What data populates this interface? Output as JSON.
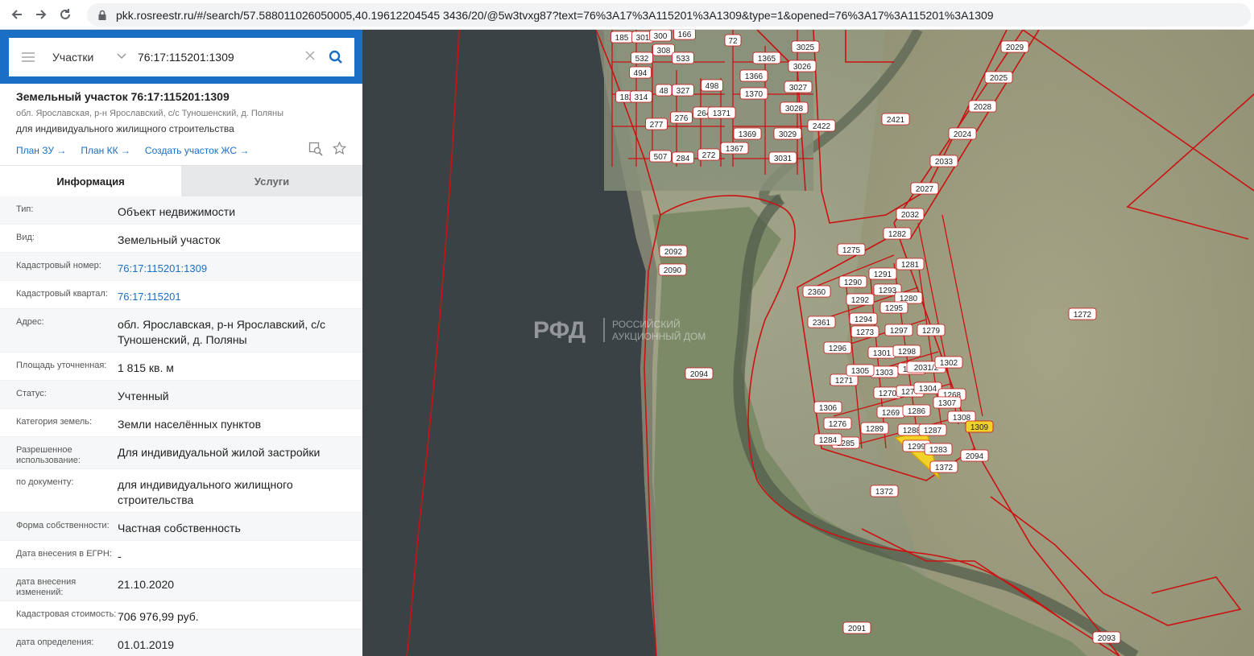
{
  "browser": {
    "url": "pkk.rosreestr.ru/#/search/57.588011026050005,40.19612204545 3436/20/@5w3tvxg87?text=76%3A17%3A115201%3A1309&type=1&opened=76%3A17%3A115201%3A1309"
  },
  "search": {
    "type_label": "Участки",
    "query": "76:17:115201:1309"
  },
  "object": {
    "title": "Земельный участок 76:17:115201:1309",
    "address": "обл. Ярославская, р-н Ярославский, с/с Туношенский, д. Поляны",
    "purpose": "для индивидуального жилищного строительства",
    "links": [
      "План ЗУ →",
      "План КК →",
      "Создать участок ЖС →"
    ]
  },
  "tabs": [
    "Информация",
    "Услуги"
  ],
  "info_rows": [
    {
      "label": "Тип:",
      "value": "Объект недвижимости"
    },
    {
      "label": "Вид:",
      "value": "Земельный участок"
    },
    {
      "label": "Кадастровый номер:",
      "value": "76:17:115201:1309",
      "link": true
    },
    {
      "label": "Кадастровый квартал:",
      "value": "76:17:115201",
      "link": true
    },
    {
      "label": "Адрес:",
      "value": "обл. Ярославская, р-н Ярославский, с/с Туношенский, д. Поляны"
    },
    {
      "label": "Площадь уточненная:",
      "value": "1 815 кв. м"
    },
    {
      "label": "Статус:",
      "value": "Учтенный"
    },
    {
      "label": "Категория земель:",
      "value": "Земли населённых пунктов"
    },
    {
      "label": "Разрешенное использование:",
      "value": "Для индивидуальной жилой застройки"
    },
    {
      "label": "по документу:",
      "value": "для индивидуального жилищного строительства"
    },
    {
      "label": "Форма собственности:",
      "value": "Частная собственность"
    },
    {
      "label": "Дата внесения в ЕГРН:",
      "value": "-"
    },
    {
      "label": "дата внесения изменений:",
      "value": "21.10.2020"
    },
    {
      "label": "Кадастровая стоимость:",
      "value": "706 976,99 руб."
    },
    {
      "label": "дата определения:",
      "value": "01.01.2019"
    }
  ],
  "map": {
    "watermark_line1": "РОССИЙСКИЙ",
    "watermark_line2": "АУКЦИОННЫЙ ДОМ",
    "parcel_labels": [
      "185",
      "301",
      "300",
      "166",
      "72",
      "3025",
      "2029",
      "532",
      "308",
      "533",
      "1365",
      "3026",
      "2025",
      "494",
      "1366",
      "3027",
      "182",
      "314",
      "48",
      "327",
      "498",
      "1370",
      "3028",
      "2028",
      "277",
      "276",
      "264",
      "1371",
      "2421",
      "2422",
      "1369",
      "3029",
      "2024",
      "507",
      "284",
      "272",
      "1367",
      "3031",
      "2033",
      "2027",
      "2032",
      "1282",
      "1275",
      "1281",
      "2092",
      "2090",
      "2360",
      "1290",
      "1291",
      "1292",
      "1293",
      "1280",
      "1294",
      "1295",
      "2361",
      "1297",
      "1279",
      "1296",
      "1273",
      "1272",
      "1301",
      "1298",
      "1303",
      "1278",
      "2031/2",
      "1302",
      "1270",
      "1271",
      "1305",
      "1277",
      "1304",
      "1268",
      "1269",
      "1286",
      "1307",
      "1308",
      "1306",
      "1276",
      "1289",
      "1288",
      "1287",
      "1309",
      "1285",
      "1284",
      "1299",
      "1283",
      "2094",
      "1372",
      "2094",
      "1372",
      "2091",
      "2093"
    ],
    "selected_parcel": "1309"
  }
}
